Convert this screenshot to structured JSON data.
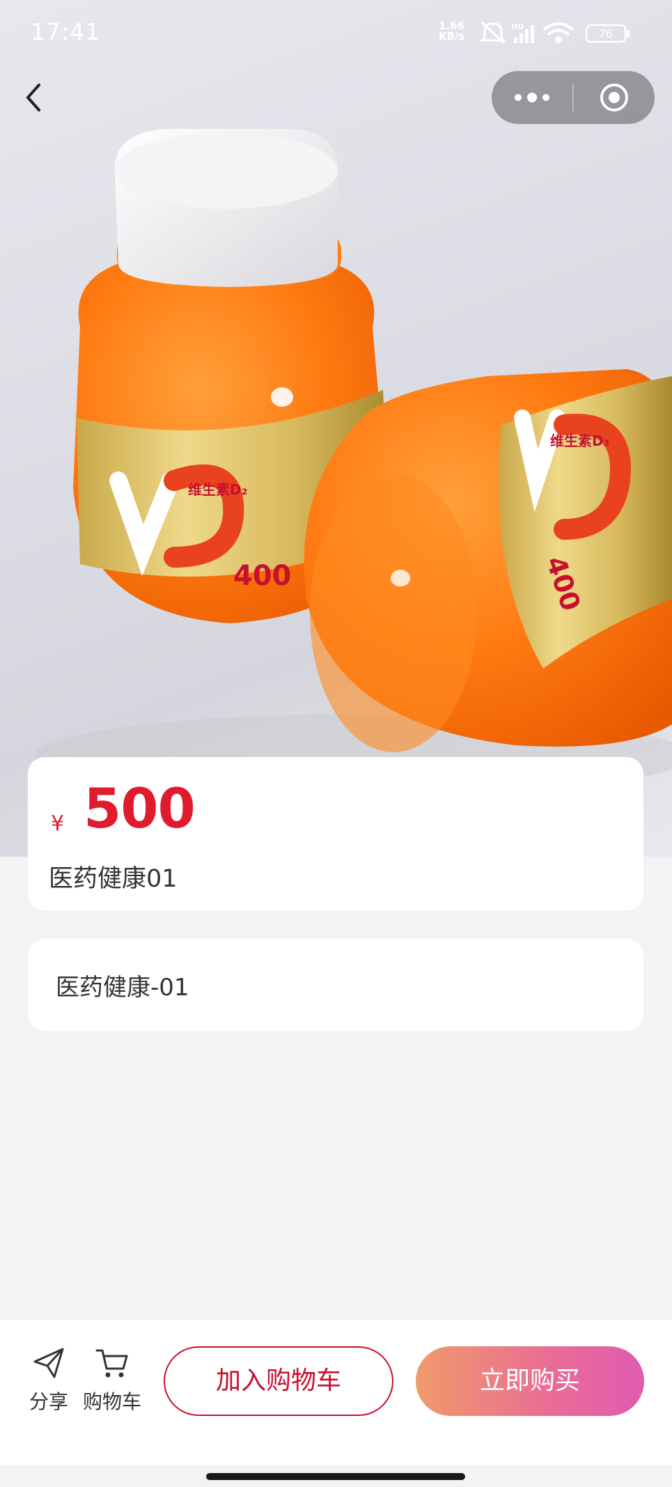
{
  "status_bar": {
    "time": "17:41",
    "speed_value": "1.66",
    "speed_unit": "KB/s",
    "network": "HD",
    "battery": "76"
  },
  "product": {
    "currency": "¥",
    "price": "500",
    "name": "医药健康01",
    "description": "医药健康-01",
    "image": {
      "label_bottle1_a": "维生素D₂",
      "label_bottle1_b": "400",
      "label_bottle2_a": "维生素D₃",
      "label_bottle2_b": "400"
    }
  },
  "bottom_bar": {
    "share_label": "分享",
    "cart_label": "购物车",
    "add_to_cart": "加入购物车",
    "buy_now": "立即购买"
  },
  "colors": {
    "price": "#e01b2e",
    "cart_button_border": "#c8102e",
    "buy_gradient_start": "#f09a6a",
    "buy_gradient_end": "#e05bb0"
  },
  "icons": [
    "back-arrow-icon",
    "more-dots-icon",
    "close-target-icon",
    "share-icon",
    "cart-icon"
  ]
}
